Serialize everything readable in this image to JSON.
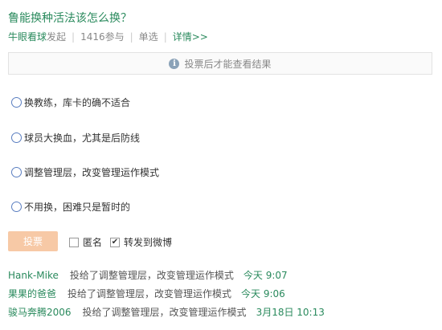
{
  "poll": {
    "title": "鲁能换种活法该怎么换？",
    "starter": "牛眼看球",
    "started_label": "发起",
    "participants": "1416参与",
    "type": "单选",
    "details_link": "详情>>"
  },
  "notice": {
    "icon": "info-icon",
    "text": "投票后才能查看结果"
  },
  "options": [
    {
      "label": "换教练，库卡的确不适合"
    },
    {
      "label": "球员大换血，尤其是后防线"
    },
    {
      "label": "调整管理层，改变管理运作模式"
    },
    {
      "label": "不用换，困难只是暂时的"
    }
  ],
  "actions": {
    "vote_button": "投票",
    "anonymous_label": "匿名",
    "anonymous_checked": false,
    "forward_label": "转发到微博",
    "forward_checked": true
  },
  "records": [
    {
      "user": "Hank-Mike",
      "action": "投给了调整管理层，改变管理运作模式",
      "time": "今天 9:07"
    },
    {
      "user": "果果的爸爸",
      "action": "投给了调整管理层，改变管理运作模式",
      "time": "今天 9:06"
    },
    {
      "user": "骏马奔腾2006",
      "action": "投给了调整管理层，改变管理运作模式",
      "time": "3月18日 10:13"
    }
  ],
  "colors": {
    "link_green": "#2a8a5d",
    "vote_button_bg": "#f7c9a6",
    "radio_border": "#5a7ec0"
  }
}
